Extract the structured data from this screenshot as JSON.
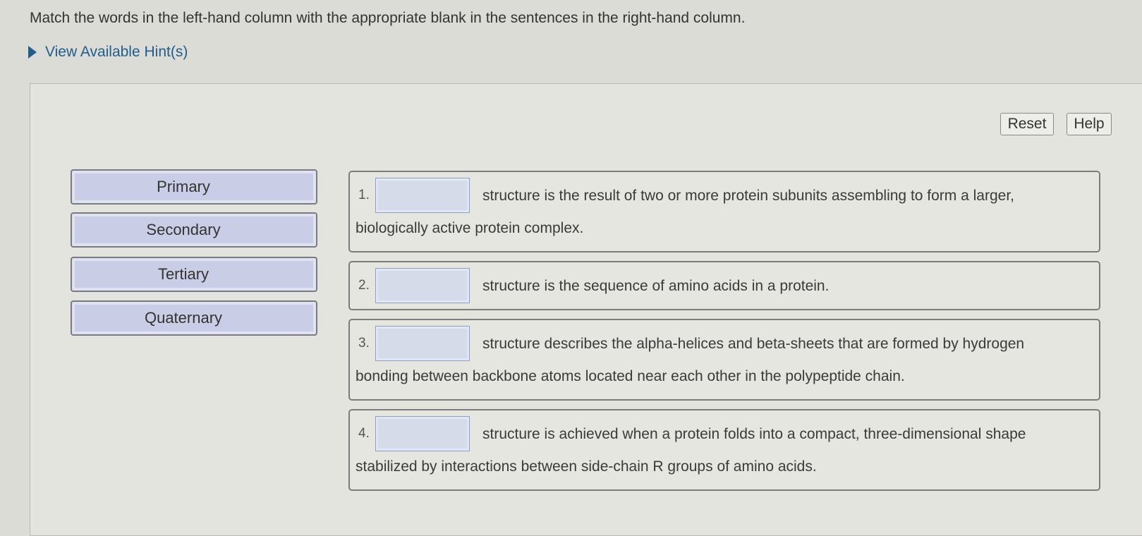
{
  "instructions": "Match the words in the left-hand column with the appropriate blank in the sentences in the right-hand column.",
  "hints": {
    "label": "View Available Hint(s)"
  },
  "toolbar": {
    "reset_label": "Reset",
    "help_label": "Help"
  },
  "words": [
    "Primary",
    "Secondary",
    "Tertiary",
    "Quaternary"
  ],
  "sentences": [
    {
      "number": "1.",
      "line1": "structure is the result of two or more protein subunits assembling to form a larger,",
      "line2": "biologically active protein complex."
    },
    {
      "number": "2.",
      "line1": "structure is the sequence of amino acids in a protein.",
      "line2": ""
    },
    {
      "number": "3.",
      "line1": "structure describes the alpha-helices and beta-sheets that are formed by hydrogen",
      "line2": "bonding between backbone atoms located near each other in the polypeptide chain."
    },
    {
      "number": "4.",
      "line1": "structure is achieved when a protein folds into a compact, three-dimensional shape",
      "line2": "stabilized by interactions between side-chain R groups of amino acids."
    }
  ]
}
